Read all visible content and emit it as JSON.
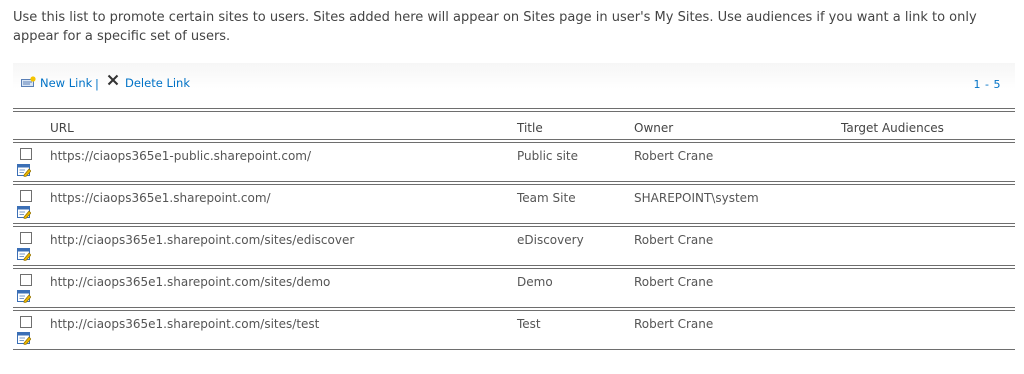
{
  "description": "Use this list to promote certain sites to users. Sites added here will appear on Sites page in user's My Sites. Use audiences if you want a link to only appear for a specific set of users.",
  "toolbar": {
    "new_link_label": "New Link",
    "separator": "|",
    "delete_link_label": "Delete Link",
    "paging": "1 - 5"
  },
  "table": {
    "headers": {
      "url": "URL",
      "title": "Title",
      "owner": "Owner",
      "target_audiences": "Target Audiences"
    },
    "rows": [
      {
        "url": "https://ciaops365e1-public.sharepoint.com/",
        "title": "Public site",
        "owner": "Robert Crane",
        "target_audiences": ""
      },
      {
        "url": "https://ciaops365e1.sharepoint.com/",
        "title": "Team Site",
        "owner": "SHAREPOINT\\system",
        "target_audiences": ""
      },
      {
        "url": "http://ciaops365e1.sharepoint.com/sites/ediscover",
        "title": "eDiscovery",
        "owner": "Robert Crane",
        "target_audiences": ""
      },
      {
        "url": "http://ciaops365e1.sharepoint.com/sites/demo",
        "title": "Demo",
        "owner": "Robert Crane",
        "target_audiences": ""
      },
      {
        "url": "http://ciaops365e1.sharepoint.com/sites/test",
        "title": "Test",
        "owner": "Robert Crane",
        "target_audiences": ""
      }
    ]
  },
  "icons": {
    "new_link": "new-link-icon",
    "delete": "delete-x-icon",
    "edit": "edit-item-icon",
    "checkbox": "checkbox"
  },
  "colors": {
    "link": "#0072c6",
    "text": "#444444",
    "rule": "#6e6e6e"
  }
}
